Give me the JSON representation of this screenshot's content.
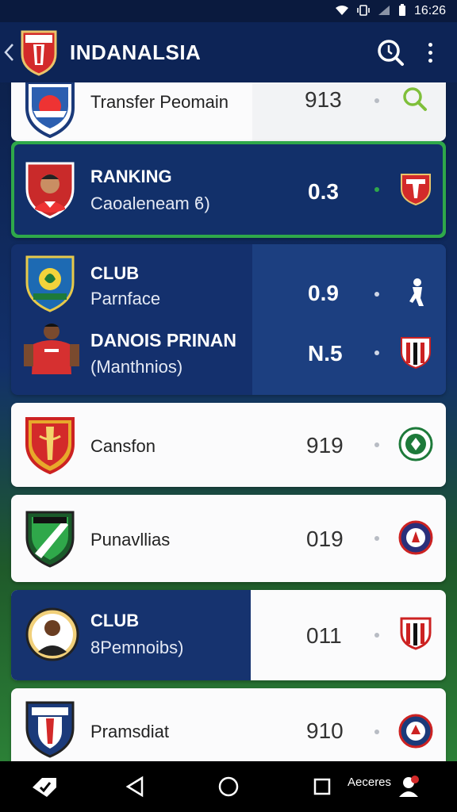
{
  "status": {
    "time": "16:26"
  },
  "header": {
    "title": "INDANALSIA"
  },
  "list": {
    "items": [
      {
        "text": "Transfer Peomain",
        "value": "913"
      },
      {
        "title": "RANKING",
        "subtitle": "Caoaleneam ϐ)",
        "value": "0.3"
      },
      {
        "title": "CLUB",
        "subtitle": "Parnface",
        "value": "0.9"
      },
      {
        "title": "DANOIS PRINAN",
        "subtitle": "(Manthnios)",
        "value": "N.5"
      },
      {
        "text": "Cansfon",
        "value": "919"
      },
      {
        "text": "Punavllias",
        "value": "019"
      },
      {
        "title": "CLUB",
        "subtitle": "8Pemnoibs)",
        "value": "011"
      },
      {
        "text": "Pramsdiat",
        "value": "910"
      }
    ]
  },
  "nav": {
    "label": "Aeceres"
  },
  "colors": {
    "bar": "#0d2456",
    "card_dark": "#14306d",
    "accent_green": "#2fa84a",
    "crest_red": "#d32a2a"
  }
}
